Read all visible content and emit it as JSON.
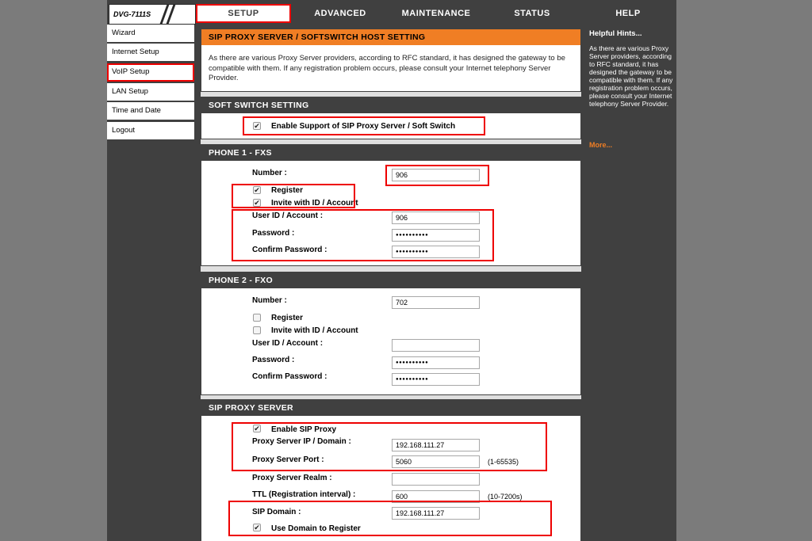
{
  "device": {
    "model": "DVG-7111S"
  },
  "tabs": [
    {
      "label": "SETUP",
      "active": true
    },
    {
      "label": "ADVANCED"
    },
    {
      "label": "MAINTENANCE"
    },
    {
      "label": "STATUS"
    },
    {
      "label": "HELP"
    }
  ],
  "sidebar": {
    "items": [
      {
        "label": "Wizard"
      },
      {
        "label": "Internet Setup"
      },
      {
        "label": "VoIP Setup",
        "selected": true
      },
      {
        "label": "LAN Setup"
      },
      {
        "label": "Time and Date"
      },
      {
        "label": "Logout"
      }
    ]
  },
  "header_section": {
    "title": "SIP PROXY SERVER / SOFTSWITCH HOST SETTING",
    "text": "As there are various Proxy Server providers, according to RFC standard, it has designed the gateway to be compatible with them. If any registration problem occurs, please consult your Internet telephony Server Provider."
  },
  "soft_switch": {
    "title": "SOFT SWITCH SETTING",
    "enable_label": "Enable Support of SIP Proxy Server / Soft Switch",
    "enable_checked": true
  },
  "phone1": {
    "title": "PHONE 1 - FXS",
    "number_label": "Number :",
    "number_value": "906",
    "register_label": "Register",
    "register_checked": true,
    "invite_label": "Invite with ID / Account",
    "invite_checked": true,
    "userid_label": "User ID / Account :",
    "userid_value": "906",
    "password_label": "Password :",
    "password_value": "●●●●●●●●●●",
    "confirm_label": "Confirm Password :",
    "confirm_value": "●●●●●●●●●●"
  },
  "phone2": {
    "title": "PHONE 2 - FXO",
    "number_label": "Number :",
    "number_value": "702",
    "register_label": "Register",
    "register_checked": false,
    "invite_label": "Invite with ID / Account",
    "invite_checked": false,
    "userid_label": "User ID / Account :",
    "userid_value": "",
    "password_label": "Password :",
    "password_value": "●●●●●●●●●●",
    "confirm_label": "Confirm Password :",
    "confirm_value": "●●●●●●●●●●"
  },
  "sip_proxy": {
    "title": "SIP PROXY SERVER",
    "enable_label": "Enable SIP Proxy",
    "enable_checked": true,
    "ip_label": "Proxy Server IP / Domain :",
    "ip_value": "192.168.111.27",
    "port_label": "Proxy Server Port :",
    "port_value": "5060",
    "port_hint": "(1-65535)",
    "realm_label": "Proxy Server Realm :",
    "realm_value": "",
    "ttl_label": "TTL (Registration interval) :",
    "ttl_value": "600",
    "ttl_hint": "(10-7200s)",
    "domain_label": "SIP Domain :",
    "domain_value": "192.168.111.27",
    "use_domain_label": "Use Domain to Register",
    "use_domain_checked": true
  },
  "help": {
    "title": "Helpful Hints...",
    "text": "As there are various Proxy Server providers, according to RFC standard, it has designed the gateway to be compatible with them. If any registration problem occurs, please consult your Internet telephony Server Provider.",
    "more": "More..."
  },
  "colors": {
    "accent": "#f07e24",
    "dark": "#404040",
    "highlight": "#e00000"
  }
}
